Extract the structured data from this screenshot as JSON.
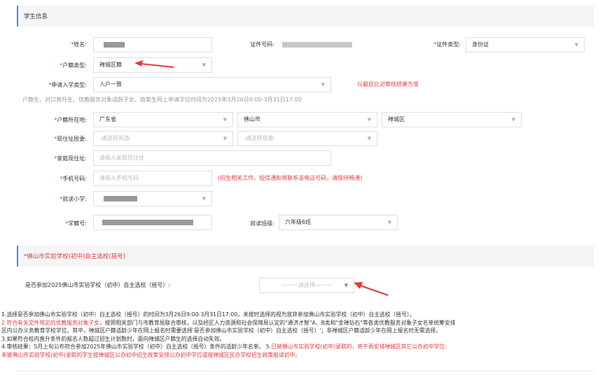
{
  "student_info": {
    "title": "学生信息",
    "name_label": "*姓名:",
    "id_number_label": "证件号码:",
    "id_type_label": "*证件类型:",
    "id_type_value": "身份证",
    "hukou_type_label": "*户籍类型:",
    "hukou_type_value": "禅城区籍",
    "apply_type_label": "*申请入学类型:",
    "apply_type_value": "人户一致",
    "apply_type_hint": "以最后比对审核结果为准",
    "apply_time_note": "户籍生、对口直升生、优教服务对象适龄子女、政策生网上申请学位时间为2025年3月26日9:00-3月31日17:00",
    "hukou_location_label": "*户籍所在地:",
    "province": "广东省",
    "city": "佛山市",
    "district": "禅城区",
    "residence_label": "*现住址居委:",
    "street_placeholder": "-请选择街道-",
    "committee_placeholder": "-请选择居委-",
    "address_label": "*家庭现住址:",
    "address_placeholder": "请输入家庭现住址",
    "phone_label": "*手机号码:",
    "phone_placeholder": "请输入手机号码",
    "phone_hint": "(招生相关工作、短信通知将联系该电话号码，请保持畅通)",
    "school_label": "*就读小学:",
    "student_no_label": "*学籍号:",
    "class_label": "就读班级:",
    "class_value": "六年级6班"
  },
  "lottery": {
    "title": "*佛山市实验学校(初中)自主选校(摇号)",
    "question": "是否参加2025佛山市实验学校（初中）自主选校（摇号）:",
    "select_placeholder": "———请选择———"
  },
  "notes": {
    "n1": "1.选择是否参加佛山市实验学校（初中）自主选校（摇号）的时间为3月26日9:00-3月31日17:00，未按时选择的视为放弃参加佛山市实验学校（初中）自主选校（摇号）。",
    "n2_red": "2.符合有关文件规定的优教服务对象子女",
    "n2_rest": "，按照相关部门与市教育局联合审核，以及经区人力资源和社会保障局认定的\"通济才智\"A、B类和\"金禅钻石\"等各类优教服务对象子女名单统筹安排",
    "n2_line2": "区内公办义务教育学校学位。其中，禅城区户籍适龄少年在网上报名时需要选择'是否参加佛山市实验学校（初中）自主选校（摇号）'；非禅城区户籍适龄少年在网上报名时无需选择。",
    "n3": "3.如果符合校内直升条件的报名人数超过招生计划数时，面向禅城区户籍生的选择自动失效。",
    "n4_a": "4.审核结果：5月上旬公布符合参加2025年佛山市实验学校（初中）自主选校（摇号）条件的适龄少年名单。 5.",
    "n4_red": "已被佛山市实验学校(初中)录取的，将不再安排禅城区其它公办初中学位;",
    "n4_line2": "未被佛山市实验学校(初中)录取的学生按禅城区公办初中招生政策安排公办初中学位或按禅城区民办学校招生政策报读初中。"
  },
  "colors": {
    "accent": "#3a8ee6",
    "red": "#e4393c"
  }
}
